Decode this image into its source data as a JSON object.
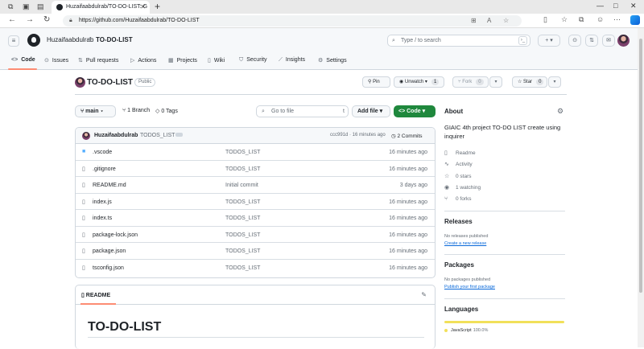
{
  "browser": {
    "tab_title": "Huzaifaabdulrab/TO-DO-LIST: G",
    "url": "https://github.com/Huzaifaabdulrab/TO-DO-LIST"
  },
  "header": {
    "owner": "Huzaifaabdulrab",
    "repo": "TO-DO-LIST",
    "search_placeholder": "Type / to search"
  },
  "repo_nav": [
    {
      "label": "Code",
      "icon": "code-icon"
    },
    {
      "label": "Issues",
      "icon": "issue-icon"
    },
    {
      "label": "Pull requests",
      "icon": "pull-request-icon"
    },
    {
      "label": "Actions",
      "icon": "play-icon"
    },
    {
      "label": "Projects",
      "icon": "table-icon"
    },
    {
      "label": "Wiki",
      "icon": "book-icon"
    },
    {
      "label": "Security",
      "icon": "shield-icon"
    },
    {
      "label": "Insights",
      "icon": "graph-icon"
    },
    {
      "label": "Settings",
      "icon": "gear-icon"
    }
  ],
  "repo": {
    "title": "TO-DO-LIST",
    "visibility": "Public",
    "pin": "Pin",
    "unwatch": "Unwatch",
    "unwatch_count": "1",
    "fork": "Fork",
    "fork_count": "0",
    "star": "Star",
    "star_count": "0"
  },
  "toolbar": {
    "branch": "main",
    "branches": "1 Branch",
    "tags": "0 Tags",
    "goto_placeholder": "Go to file",
    "goto_kbd": "t",
    "add_file": "Add file",
    "code": "Code"
  },
  "latest_commit": {
    "author": "Huzaifaabdulrab",
    "message": "TODOS_LIST",
    "hash_time": "ccc991d · 16 minutes ago",
    "commits": "2 Commits"
  },
  "files": [
    {
      "name": ".vscode",
      "type": "folder",
      "message": "TODOS_LIST",
      "date": "16 minutes ago"
    },
    {
      "name": ".gitignore",
      "type": "file",
      "message": "TODOS_LIST",
      "date": "16 minutes ago"
    },
    {
      "name": "README.md",
      "type": "file",
      "message": "Initial commit",
      "date": "3 days ago"
    },
    {
      "name": "index.js",
      "type": "file",
      "message": "TODOS_LIST",
      "date": "16 minutes ago"
    },
    {
      "name": "index.ts",
      "type": "file",
      "message": "TODOS_LIST",
      "date": "16 minutes ago"
    },
    {
      "name": "package-lock.json",
      "type": "file",
      "message": "TODOS_LIST",
      "date": "16 minutes ago"
    },
    {
      "name": "package.json",
      "type": "file",
      "message": "TODOS_LIST",
      "date": "16 minutes ago"
    },
    {
      "name": "tsconfig.json",
      "type": "file",
      "message": "TODOS_LIST",
      "date": "16 minutes ago"
    }
  ],
  "readme": {
    "tab": "README",
    "heading": "TO-DO-LIST"
  },
  "sidebar": {
    "about_title": "About",
    "description": "GIAIC 4th project TO-DO LIST create using inquirer",
    "readme": "Readme",
    "activity": "Activity",
    "stars": "0 stars",
    "watching": "1 watching",
    "forks": "0 forks",
    "releases_title": "Releases",
    "releases_none": "No releases published",
    "releases_link": "Create a new release",
    "packages_title": "Packages",
    "packages_none": "No packages published",
    "packages_link": "Publish your first package",
    "languages_title": "Languages",
    "language": "JavaScript",
    "language_pct": "100.0%",
    "language_color": "#f1e05a"
  }
}
